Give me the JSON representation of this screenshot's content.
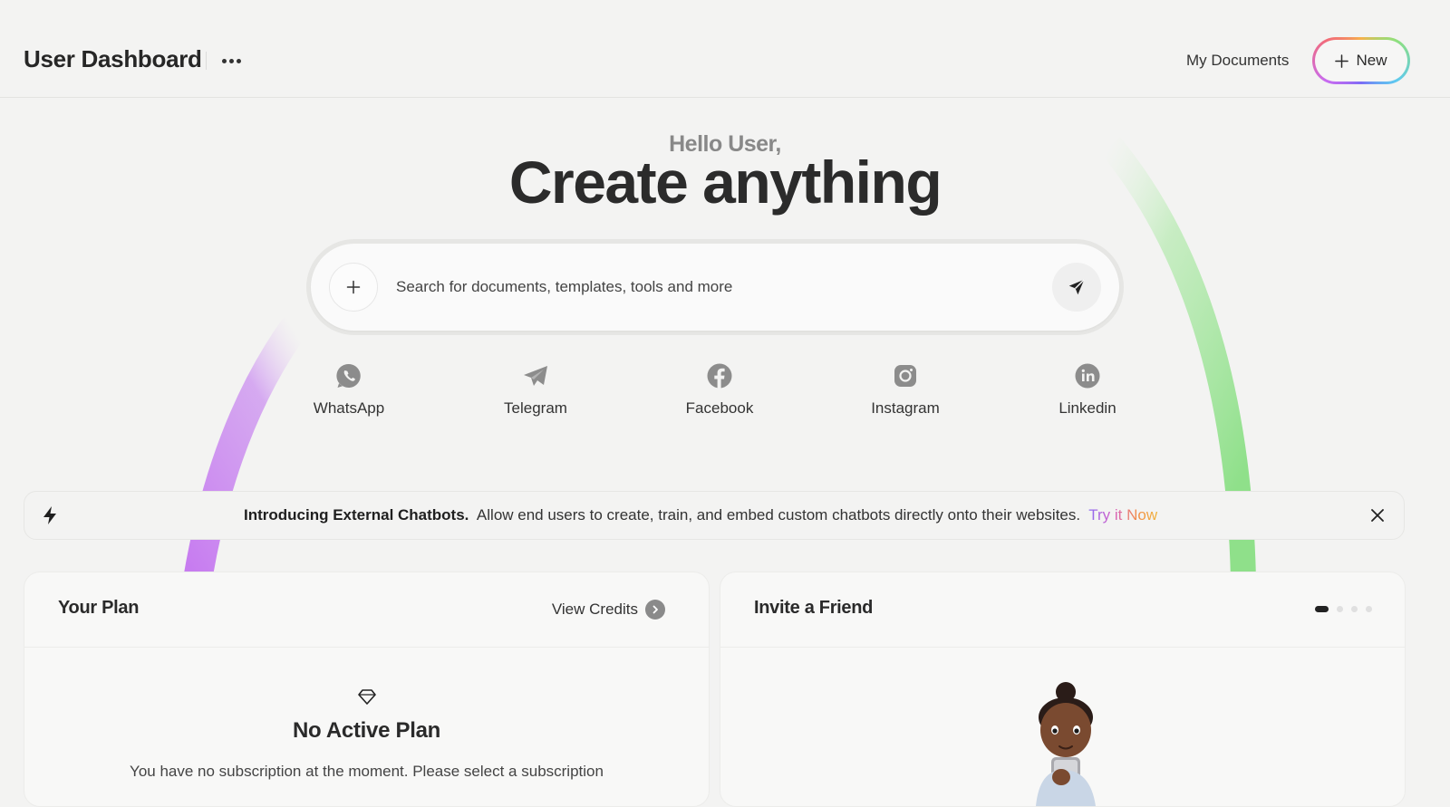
{
  "header": {
    "title": "User Dashboard",
    "more_icon": "more-horizontal-icon",
    "my_documents_label": "My Documents",
    "new_button_label": "New"
  },
  "hero": {
    "greeting": "Hello User,",
    "headline": "Create anything"
  },
  "search": {
    "placeholder": "Search for documents, templates, tools and more",
    "value": "",
    "attach_icon": "plus-icon",
    "send_icon": "send-icon"
  },
  "channels": [
    {
      "label": "WhatsApp",
      "icon": "whatsapp-icon"
    },
    {
      "label": "Telegram",
      "icon": "telegram-icon"
    },
    {
      "label": "Facebook",
      "icon": "facebook-icon"
    },
    {
      "label": "Instagram",
      "icon": "instagram-icon"
    },
    {
      "label": "Linkedin",
      "icon": "linkedin-icon"
    }
  ],
  "banner": {
    "heading": "Introducing External Chatbots.",
    "message": "Allow end users to create, train, and embed custom chatbots directly onto their websites.",
    "link_label": "Try it Now"
  },
  "plan_card": {
    "title": "Your Plan",
    "view_credits_label": "View Credits",
    "status_title": "No Active Plan",
    "status_message": "You have no subscription at the moment. Please select a subscription"
  },
  "invite_card": {
    "title": "Invite a Friend",
    "carousel_pages": 4,
    "carousel_active_page": 1
  },
  "colors": {
    "background": "#f3f3f2",
    "arc_left": "#c77cf0",
    "arc_right": "#8fe08a",
    "text_primary": "#2b2b2b",
    "text_muted": "#888888"
  }
}
